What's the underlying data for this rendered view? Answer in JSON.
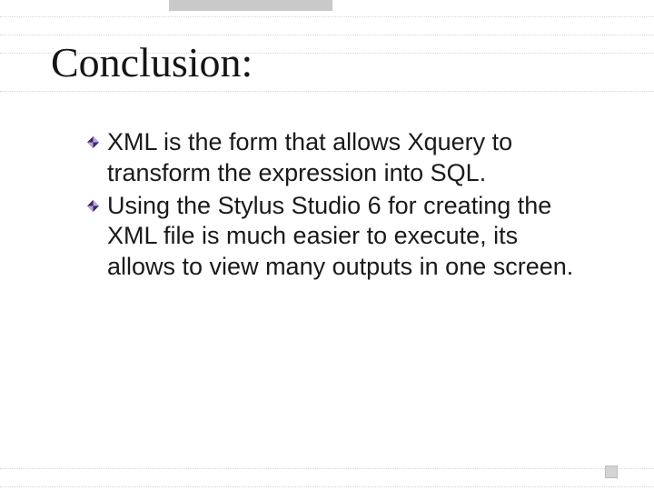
{
  "title": "Conclusion:",
  "bullets": [
    "XML is the form that allows Xquery to transform the expression into SQL.",
    "Using the Stylus Studio 6 for creating the XML file is much easier to execute, its allows to view many outputs in one screen."
  ],
  "colors": {
    "bullet_dark": "#40246a",
    "bullet_light": "#b9a8d8"
  }
}
